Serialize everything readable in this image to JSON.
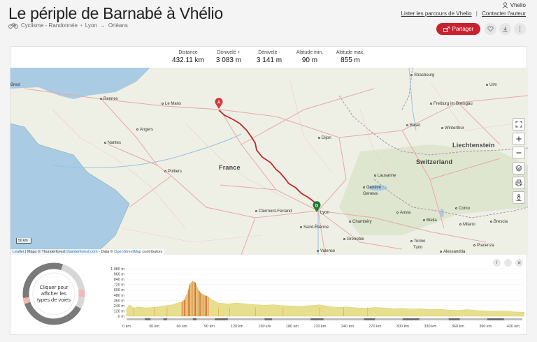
{
  "header": {
    "title": "Le périple de Barnabé à Vhélio",
    "category": "Cyclisme - Randonnée",
    "route_from": "Lyon",
    "route_arrow": "→",
    "route_to": "Orléans",
    "dot": "•",
    "user_name": "Vhelio",
    "link_list": "Lister les parcours de Vhelio",
    "link_sep": "|",
    "link_contact": "Contacter l'auteur",
    "share_label": "Partager",
    "icons": [
      "bike-icon",
      "user-icon",
      "share-icon",
      "heart-icon",
      "download-icon",
      "more-icon"
    ],
    "accent_color": "#c9202e"
  },
  "stats": [
    {
      "label": "Distance",
      "value": "432.11 km"
    },
    {
      "label": "Dénivelé +",
      "value": "3 083 m"
    },
    {
      "label": "Dénivelé -",
      "value": "3 141 m"
    },
    {
      "label": "Altitude min.",
      "value": "90 m"
    },
    {
      "label": "Altitude max.",
      "value": "855 m"
    }
  ],
  "map": {
    "countries": {
      "france": "France",
      "switzerland": "Switzerland",
      "liechtenstein": "Liechtenstein"
    },
    "cities": {
      "brest": "Brest",
      "rennes": "Rennes",
      "le_mans": "Le Mans",
      "angers": "Angers",
      "nantes": "Nantes",
      "poitiers": "Poitiers",
      "clermont": "Clermont-Ferrand",
      "saint_etienne": "Saint-Étienne",
      "lyon": "Lyon",
      "valence": "Valence",
      "grenoble": "Grenoble",
      "chambery": "Chambéry",
      "dijon": "Dijon",
      "strasbourg": "Strasbourg",
      "freiburg": "Freiburg im Breisgau",
      "basel": "Basel",
      "winterthur": "Winterthur",
      "ulm": "Ulm",
      "lausanne": "Lausanne",
      "geneve": "Genève",
      "geneva": "Geneva",
      "aosta": "Aosta",
      "biella": "Biella",
      "como": "Como",
      "milano": "Milano",
      "brescia": "Brescia",
      "torino": "Torino",
      "turin": "Turin",
      "piacenza": "Piacenza",
      "alessandria": "Alessandria"
    },
    "marker_start": "A",
    "marker_end": "D",
    "scale_label": "50 km",
    "attribution_leaflet": "Leaflet",
    "attribution_text": " | Maps © Thunderforest ",
    "attribution_tf_link": "thunderforest.com",
    "attribution_mid": " - Data © ",
    "attribution_osm": "OpenStreetMap",
    "attribution_end": " contributors",
    "controls": [
      "fullscreen-icon",
      "zoom-in-icon",
      "zoom-out-icon",
      "layers-icon",
      "print-icon",
      "pegman-icon"
    ],
    "route_color": "#c0262e"
  },
  "donut": {
    "text_line1": "Cliquer pour",
    "text_line2": "afficher les",
    "text_line3": "types de voies"
  },
  "chart_data": {
    "type": "area",
    "title": "",
    "xlabel": "",
    "ylabel": "",
    "ylim": [
      0,
      1080
    ],
    "xlim": [
      0,
      430
    ],
    "yticks": [
      "1 080 m",
      "960 m",
      "840 m",
      "720 m",
      "600 m",
      "480 m",
      "360 m",
      "240 m",
      "120 m",
      "0 m"
    ],
    "ytick_values": [
      1080,
      960,
      840,
      720,
      600,
      480,
      360,
      240,
      120,
      0
    ],
    "xticks": [
      "0 km",
      "30 km",
      "60 km",
      "90 km",
      "120 km",
      "150 km",
      "180 km",
      "210 km",
      "240 km",
      "270 km",
      "300 km",
      "330 km",
      "360 km",
      "390 km",
      "420 km"
    ],
    "xtick_values": [
      0,
      30,
      60,
      90,
      120,
      150,
      180,
      210,
      240,
      270,
      300,
      330,
      360,
      390,
      420
    ],
    "series": [
      {
        "x": [
          0,
          3,
          5,
          8,
          12,
          20,
          30,
          40,
          50,
          55,
          60,
          63,
          66,
          69,
          72,
          75,
          78,
          81,
          84,
          87,
          90,
          95,
          100,
          110,
          120,
          130,
          140,
          150,
          160,
          170,
          180,
          190,
          200,
          210,
          220,
          230,
          240,
          250,
          260,
          270,
          280,
          290,
          300,
          310,
          320,
          330,
          340,
          350,
          360,
          370,
          380,
          390,
          400,
          410,
          420,
          432
        ],
        "values": [
          170,
          260,
          230,
          180,
          210,
          190,
          200,
          230,
          260,
          300,
          320,
          380,
          520,
          740,
          800,
          760,
          600,
          520,
          480,
          460,
          420,
          350,
          300,
          280,
          300,
          280,
          260,
          250,
          260,
          240,
          230,
          220,
          240,
          260,
          220,
          200,
          210,
          190,
          180,
          200,
          190,
          170,
          180,
          160,
          170,
          150,
          160,
          140,
          130,
          150,
          130,
          120,
          110,
          120,
          100,
          90
        ]
      }
    ],
    "fill_color": "#e8df8e",
    "steep_color": "#d24b1f"
  }
}
